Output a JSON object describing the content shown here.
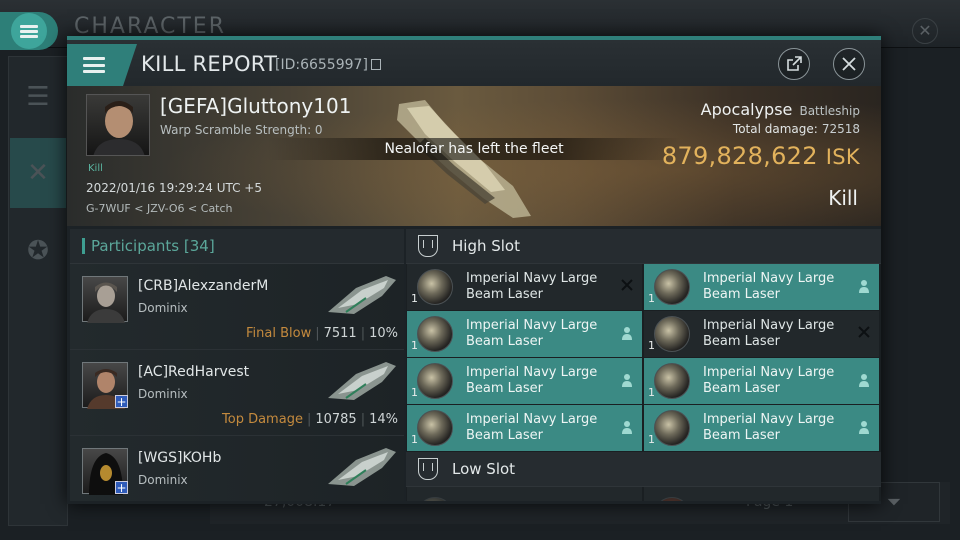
{
  "background": {
    "title": "CHARACTER",
    "bottom_value": "27,008.17",
    "page_label": "Page 1"
  },
  "header": {
    "title": "KILL REPORT",
    "report_id": "[ID:6655997]"
  },
  "victim": {
    "name": "[GEFA]Gluttony101",
    "warp_scramble": "Warp Scramble Strength: 0",
    "kill_tag": "Kill",
    "datetime": "2022/01/16 19:29:24 UTC +5",
    "location": "G-7WUF < JZV-O6 < Catch",
    "ship_name": "Apocalypse",
    "ship_class": "Battleship",
    "total_damage_label": "Total damage:",
    "total_damage": "72518",
    "isk_value": "879,828,622",
    "isk_unit": "ISK",
    "result": "Kill"
  },
  "notice": "Nealofar has left the fleet",
  "participants": {
    "header": "Participants [34]",
    "rows": [
      {
        "name": "[CRB]AlexzanderM",
        "ship": "Dominix",
        "tag": "Final Blow",
        "damage": "7511",
        "percent": "10%"
      },
      {
        "name": "[AC]RedHarvest",
        "ship": "Dominix",
        "tag": "Top Damage",
        "damage": "10785",
        "percent": "14%"
      },
      {
        "name": "[WGS]KOHb",
        "ship": "Dominix",
        "tag": "",
        "damage": "",
        "percent": ""
      }
    ]
  },
  "fitting": {
    "high_slot_label": "High Slot",
    "low_slot_label": "Low Slot",
    "high_slot_modules": [
      {
        "name": "Imperial Navy Large Beam Laser",
        "qty": "1",
        "state": "destroyed"
      },
      {
        "name": "Imperial Navy Large Beam Laser",
        "qty": "1",
        "state": "dropped"
      },
      {
        "name": "Imperial Navy Large Beam Laser",
        "qty": "1",
        "state": "dropped"
      },
      {
        "name": "Imperial Navy Large Beam Laser",
        "qty": "1",
        "state": "destroyed"
      },
      {
        "name": "Imperial Navy Large Beam Laser",
        "qty": "1",
        "state": "dropped"
      },
      {
        "name": "Imperial Navy Large Beam Laser",
        "qty": "1",
        "state": "dropped"
      },
      {
        "name": "Imperial Navy Large Beam Laser",
        "qty": "1",
        "state": "dropped"
      },
      {
        "name": "Imperial Navy Large Beam Laser",
        "qty": "1",
        "state": "dropped"
      }
    ]
  },
  "icons": {
    "menu": "hamburger-icon",
    "copy": "copy-icon",
    "share": "external-link-icon",
    "close": "close-icon",
    "destroyed": "x-mark-icon",
    "dropped": "person-icon",
    "slot": "shield-slot-icon"
  },
  "colors": {
    "accent": "#2f7f7a",
    "dropped_bg": "#3b8a84",
    "isk": "#e2b25c",
    "tag_orange": "#c48a3e"
  }
}
